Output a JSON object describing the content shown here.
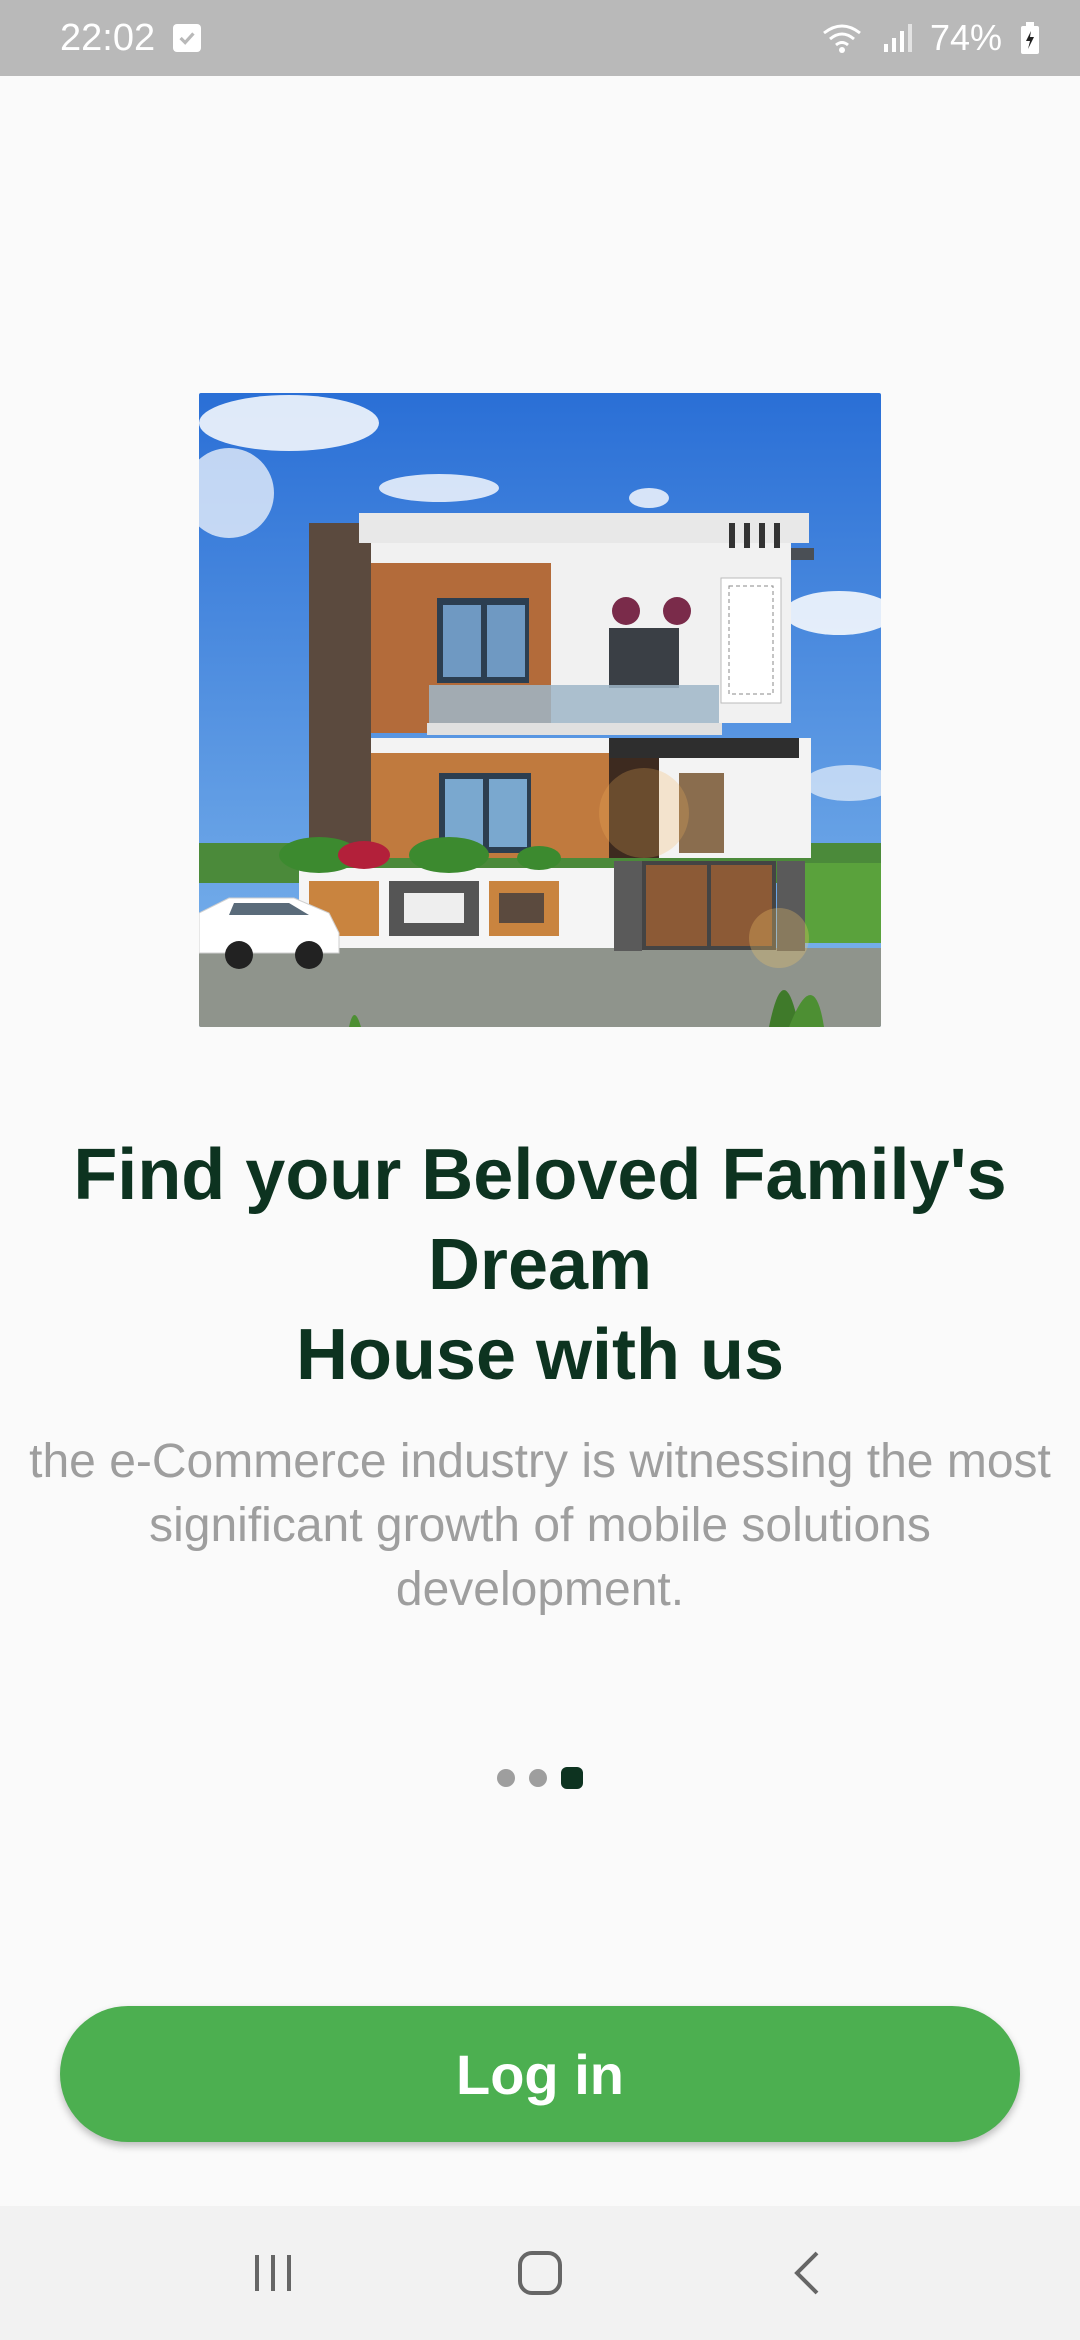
{
  "status_bar": {
    "time": "22:02",
    "battery": "74%",
    "icons": [
      "check-notification-icon",
      "wifi-icon",
      "signal-icon",
      "battery-icon"
    ]
  },
  "onboarding": {
    "image_alt": "modern two-storey house",
    "headline": "Find your Beloved Family's\nDream\nHouse with us",
    "subtitle": "the e-Commerce industry is witnessing the most significant growth of mobile solutions development.",
    "page_count": 3,
    "active_page": 3
  },
  "actions": {
    "login_label": "Log in"
  },
  "nav_bar": {
    "icons": [
      "recent-apps-icon",
      "home-icon",
      "back-icon"
    ]
  },
  "colors": {
    "accent": "#4caf50",
    "headline": "#0d3320",
    "subtitle": "#9e9e9e",
    "status_bar": "#b9b9b9"
  }
}
